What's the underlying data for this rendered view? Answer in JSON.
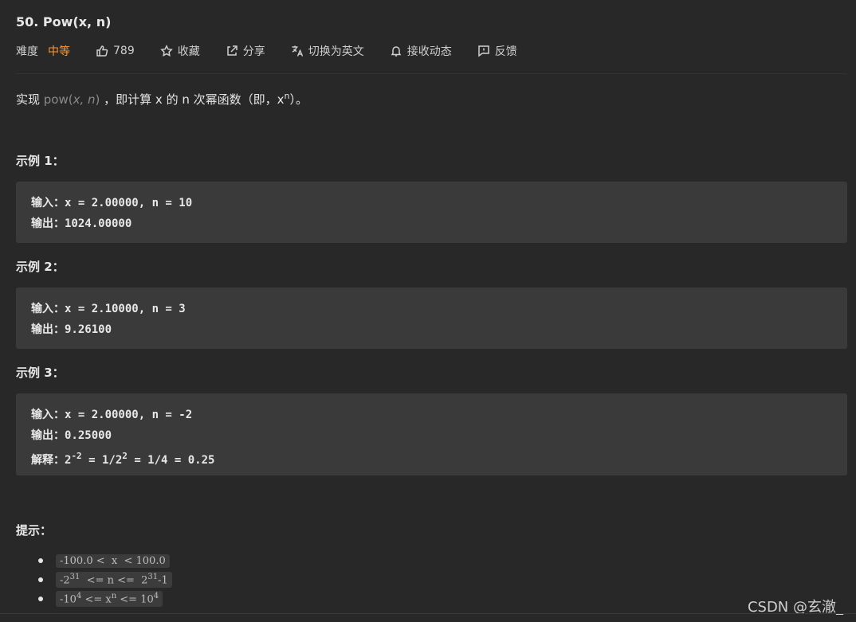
{
  "problem": {
    "title": "50. Pow(x, n)",
    "difficulty_label": "难度",
    "difficulty": "中等",
    "likes": "789",
    "favorite": "收藏",
    "share": "分享",
    "switch_lang": "切换为英文",
    "subscribe": "接收动态",
    "feedback": "反馈"
  },
  "description": {
    "prefix": "实现 ",
    "code_func": "pow(",
    "code_args": "x, n",
    "code_close": ")",
    "middle": " ，即计算 x 的 n 次幂函数（即，x",
    "sup": "n",
    "suffix": "）。"
  },
  "examples": [
    {
      "title": "示例 1：",
      "input_label": "输入：",
      "input_value": "x = 2.00000, n = 10",
      "output_label": "输出：",
      "output_value": "1024.00000"
    },
    {
      "title": "示例 2：",
      "input_label": "输入：",
      "input_value": "x = 2.10000, n = 3",
      "output_label": "输出：",
      "output_value": "9.26100"
    },
    {
      "title": "示例 3：",
      "input_label": "输入：",
      "input_value": "x = 2.00000, n = -2",
      "output_label": "输出：",
      "output_value": "0.25000",
      "explain_label": "解释：",
      "explain_a": "2",
      "explain_a_sup": "-2",
      "explain_b": " = 1/2",
      "explain_b_sup": "2",
      "explain_c": " = 1/4 = 0.25"
    }
  ],
  "hints": {
    "title": "提示：",
    "h1": "-100.0 <  x  < 100.0",
    "h2_a": "-2",
    "h2_a_sup": "31",
    "h2_b": "  <= n <=  2",
    "h2_b_sup": "31",
    "h2_c": "-1",
    "h3_a": "-10",
    "h3_a_sup": "4",
    "h3_b": " <= x",
    "h3_b_sup": "n",
    "h3_c": " <= 10",
    "h3_c_sup": "4"
  },
  "watermark": "CSDN @玄澈_",
  "colors": {
    "background": "#282828",
    "code_box": "#3a3a3a",
    "difficulty_medium": "#ff9a2e"
  },
  "icons": [
    "thumbs-up-icon",
    "star-icon",
    "share-icon",
    "translate-icon",
    "bell-icon",
    "feedback-icon"
  ]
}
